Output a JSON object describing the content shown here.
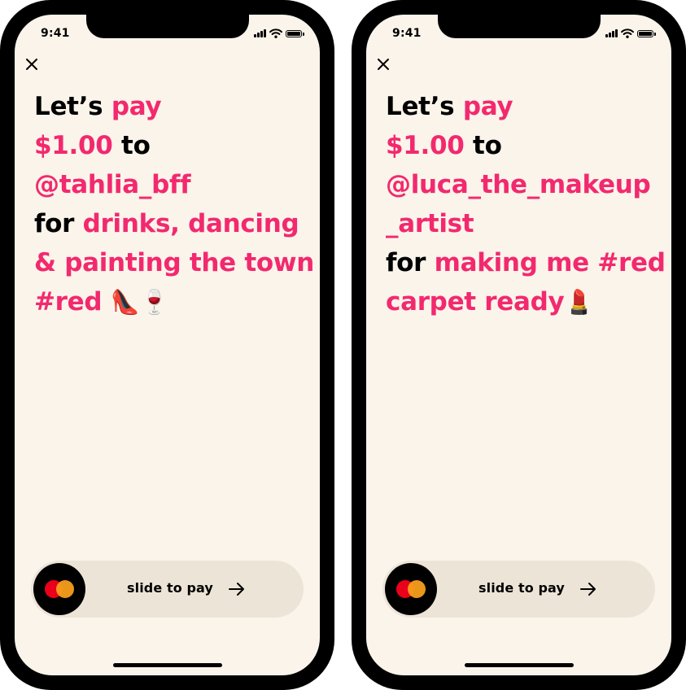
{
  "status_bar": {
    "time": "9:41"
  },
  "accent_color": "#f2296f",
  "screens": [
    {
      "lines": [
        [
          {
            "text": "Let’s ",
            "hl": false
          },
          {
            "text": "pay",
            "hl": true
          }
        ],
        [
          {
            "text": "$1.00",
            "hl": true
          },
          {
            "text": " to",
            "hl": false
          }
        ],
        [
          {
            "text": "@tahlia_bff",
            "hl": true
          }
        ],
        [
          {
            "text": "for ",
            "hl": false
          },
          {
            "text": "drinks, dancing",
            "hl": true
          }
        ],
        [
          {
            "text": "& painting the town",
            "hl": true
          }
        ],
        [
          {
            "text": "#red ",
            "hl": true
          },
          {
            "text": "👠🍷",
            "emoji": true
          }
        ]
      ]
    },
    {
      "lines": [
        [
          {
            "text": "Let’s ",
            "hl": false
          },
          {
            "text": "pay",
            "hl": true
          }
        ],
        [
          {
            "text": "$1.00",
            "hl": true
          },
          {
            "text": " to",
            "hl": false
          }
        ],
        [
          {
            "text": "@luca_the_makeup",
            "hl": true
          }
        ],
        [
          {
            "text": "_artist",
            "hl": true
          }
        ],
        [
          {
            "text": "for ",
            "hl": false
          },
          {
            "text": "making me #red",
            "hl": true
          }
        ],
        [
          {
            "text": "carpet ready",
            "hl": true
          },
          {
            "text": "💄",
            "emoji": true
          }
        ]
      ]
    }
  ],
  "slider": {
    "label": "slide to pay"
  },
  "icons": {
    "close": "close-icon",
    "card": "mastercard-icon",
    "arrow": "arrow-right-icon",
    "signal": "cellular-signal-icon",
    "wifi": "wifi-icon",
    "battery": "battery-icon"
  }
}
